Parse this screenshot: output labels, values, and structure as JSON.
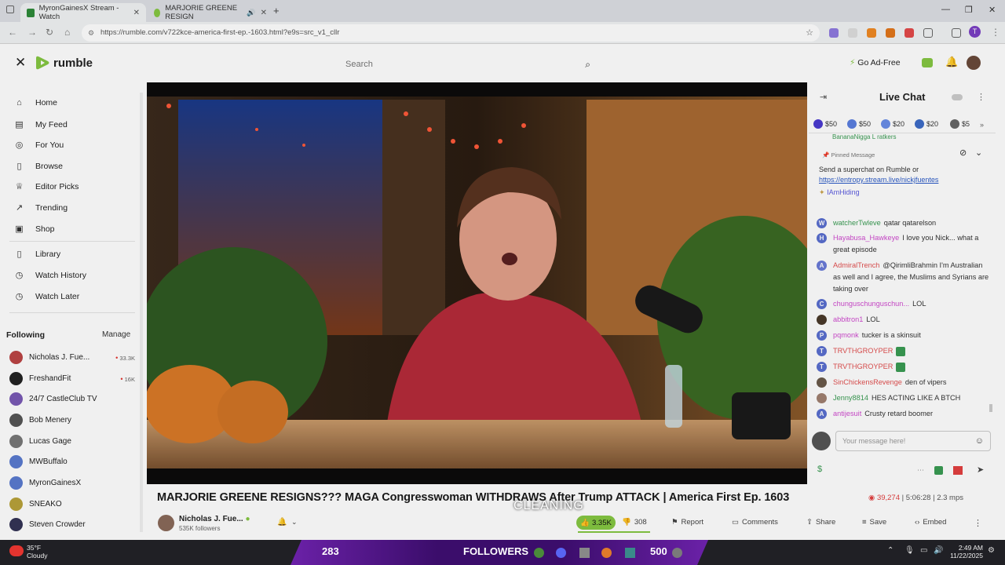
{
  "browser": {
    "tabs": [
      {
        "label": "MyronGainesX Stream - Watch",
        "active": true
      },
      {
        "label": "MARJORIE GREENE RESIGN",
        "active": false
      }
    ],
    "url": "https://rumble.com/v722kce-america-first-ep.-1603.html?e9s=src_v1_cllr",
    "profile_initial": "T"
  },
  "header": {
    "logo": "rumble",
    "search_placeholder": "Search",
    "ad_free": "Go Ad-Free"
  },
  "sidebar": {
    "nav": [
      {
        "label": "Home",
        "icon": "home-icon",
        "glyph": "⌂"
      },
      {
        "label": "My Feed",
        "icon": "feed-icon",
        "glyph": "▤"
      },
      {
        "label": "For You",
        "icon": "target-icon",
        "glyph": "◎"
      },
      {
        "label": "Browse",
        "icon": "browse-icon",
        "glyph": "▯"
      },
      {
        "label": "Editor Picks",
        "icon": "bulb-icon",
        "glyph": "♕"
      },
      {
        "label": "Trending",
        "icon": "trending-icon",
        "glyph": "↗"
      },
      {
        "label": "Shop",
        "icon": "shop-icon",
        "glyph": "▣"
      }
    ],
    "library": [
      {
        "label": "Library",
        "icon": "library-icon",
        "glyph": "▯"
      },
      {
        "label": "Watch History",
        "icon": "history-icon",
        "glyph": "◷"
      },
      {
        "label": "Watch Later",
        "icon": "clock-icon",
        "glyph": "◷"
      }
    ],
    "following_title": "Following",
    "manage": "Manage",
    "following": [
      {
        "name": "Nicholas J. Fue...",
        "count": "33.3K",
        "live": true,
        "color": "#b44"
      },
      {
        "name": "FreshandFit",
        "count": "16K",
        "live": true,
        "color": "#222"
      },
      {
        "name": "24/7 CastleClub TV",
        "count": "",
        "live": false,
        "color": "#7a5ab5"
      },
      {
        "name": "Bob Menery",
        "count": "",
        "live": false,
        "color": "#555"
      },
      {
        "name": "Lucas Gage",
        "count": "",
        "live": false,
        "color": "#777"
      },
      {
        "name": "MWBuffalo",
        "count": "",
        "live": false,
        "color": "#5a7bd0"
      },
      {
        "name": "MyronGainesX",
        "count": "",
        "live": false,
        "color": "#5a7bd0"
      },
      {
        "name": "SNEAKO",
        "count": "",
        "live": false,
        "color": "#b8a23a"
      },
      {
        "name": "Steven Crowder",
        "count": "",
        "live": false,
        "color": "#335"
      }
    ]
  },
  "video": {
    "title": "MARJORIE GREENE RESIGNS??? MAGA Congresswoman WITHDRAWS After Trump ATTACK | America First Ep. 1603",
    "viewers": "39,274",
    "duration": "5:06:28",
    "bitrate": "2.3 mps",
    "channel": "Nicholas J. Fue...",
    "followers": "535K followers",
    "likes": "3.35K",
    "dislikes": "308",
    "actions": [
      "Report",
      "Comments",
      "Share",
      "Save",
      "Embed"
    ]
  },
  "chat": {
    "title": "Live Chat",
    "rants": [
      {
        "amount": "$50",
        "color": "#4b3bd1"
      },
      {
        "amount": "$50",
        "color": "#5b7fe0"
      },
      {
        "amount": "$20",
        "color": "#6a8ee8"
      },
      {
        "amount": "$20",
        "color": "#3d6cc7"
      },
      {
        "amount": "$5",
        "color": "#666"
      }
    ],
    "top_cut": "BananaNigga  L ratkers",
    "pinned_label": "Pinned Message",
    "pinned_text": "Send a superchat on Rumble or",
    "pinned_link": "https://entropy.stream.live/nickjfuentes",
    "pinned_user": "IAmHiding",
    "messages": [
      {
        "user": "watcherTwleve",
        "text": "qatar qatarelson",
        "color": "#3a9c53",
        "initial": "W",
        "avbg": "#5a6fd0"
      },
      {
        "user": "Hayabusa_Hawkeye",
        "text": "I love you Nick... what a great episode",
        "color": "#d04bd0",
        "initial": "H",
        "avbg": "#5a6fd0"
      },
      {
        "user": "AdmiralTrench",
        "text": "@QirimliBrahmin I'm Australian as well and I agree, the Muslims and Syrians are taking over",
        "color": "#e35050",
        "initial": "A",
        "avbg": "#6a7bd8"
      },
      {
        "user": "chunguschunguschun...",
        "text": "LOL",
        "color": "#d04bd0",
        "initial": "C",
        "avbg": "#5a6fd0"
      },
      {
        "user": "abbitron1",
        "text": "LOL",
        "color": "#d04bd0",
        "initial": "",
        "avbg": "#4a3a2a"
      },
      {
        "user": "pqmonk",
        "text": "tucker is a skinsuit",
        "color": "#d04bd0",
        "initial": "P",
        "avbg": "#5a6fd0"
      },
      {
        "user": "TRVTHGROYPER",
        "text": "",
        "color": "#e35050",
        "initial": "T",
        "avbg": "#5a6fd0"
      },
      {
        "user": "TRVTHGROYPER",
        "text": "",
        "color": "#e35050",
        "initial": "T",
        "avbg": "#5a6fd0"
      },
      {
        "user": "SinChickensRevenge",
        "text": "den of vipers",
        "color": "#e35050",
        "initial": "",
        "avbg": "#6a5a4a"
      },
      {
        "user": "Jenny8814",
        "text": "HES ACTING LIKE A BTCH",
        "color": "#3a9c53",
        "initial": "",
        "avbg": "#a08070"
      },
      {
        "user": "antijesuit",
        "text": "Crusty retard boomer",
        "color": "#d04bd0",
        "initial": "A",
        "avbg": "#5a6fd0"
      }
    ],
    "input_placeholder": "Your message here!"
  },
  "overlay": {
    "left_count": "283",
    "center_label": "FOLLOWERS",
    "right_count": "500",
    "cleaning": "CLEANING"
  },
  "taskbar": {
    "temp": "35°F",
    "weather": "Cloudy",
    "time": "2:49 AM",
    "date": "11/22/2025"
  }
}
